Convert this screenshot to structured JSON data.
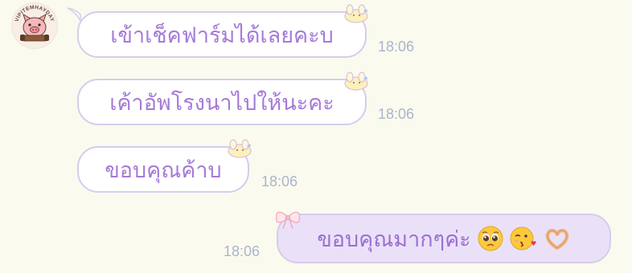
{
  "chat": {
    "avatar": {
      "icon": "pig-avatar-icon",
      "badge_text": "VIPITEMHAYDAY"
    },
    "messages": [
      {
        "direction": "incoming",
        "text": "เข้าเช็คฟาร์มได้เลยคะบ",
        "time": "18:06"
      },
      {
        "direction": "incoming",
        "text": "เค้าอัพโรงนาไปให้นะคะ",
        "time": "18:06"
      },
      {
        "direction": "incoming",
        "text": "ขอบคุณค้าบ",
        "time": "18:06"
      },
      {
        "direction": "outgoing",
        "text": "ขอบคุณมากๆค่ะ",
        "time": "18:06",
        "emojis": [
          "pleading-face-emoji",
          "face-blowing-kiss-emoji",
          "heart-hands-emoji"
        ]
      }
    ]
  },
  "colors": {
    "background": "#fbfaee",
    "incoming_bubble": "#ffffff",
    "outgoing_bubble": "#eae1f8",
    "bubble_border": "#d6ccec",
    "text_purple": "#a57ad8",
    "timestamp": "#a9b5cd"
  }
}
